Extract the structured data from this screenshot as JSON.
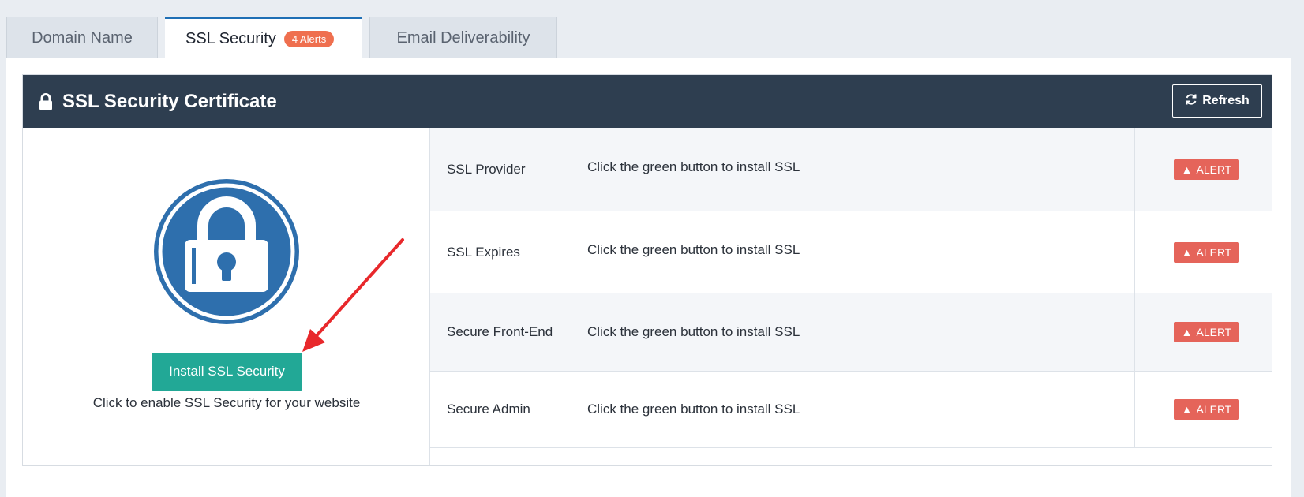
{
  "tabs": [
    {
      "label": "Domain Name"
    },
    {
      "label": "SSL Security",
      "badge": "4 Alerts"
    },
    {
      "label": "Email Deliverability"
    }
  ],
  "card": {
    "title": "SSL Security Certificate",
    "refresh_label": "Refresh",
    "install_label": "Install SSL Security",
    "install_hint": "Click to enable SSL Security for your website"
  },
  "rows": [
    {
      "label": "SSL Provider",
      "value": "Click the green button to install SSL",
      "status": "ALERT"
    },
    {
      "label": "SSL Expires",
      "value": "Click the green button to install SSL",
      "status": "ALERT"
    },
    {
      "label": "Secure Front-End",
      "value": "Click the green button to install SSL",
      "status": "ALERT"
    },
    {
      "label": "Secure Admin",
      "value": "Click the green button to install SSL",
      "status": "ALERT"
    }
  ],
  "colors": {
    "header_bg": "#2e3e50",
    "install_green": "#22a896",
    "alert_red": "#e5645a",
    "badge_orange": "#ef6f4f",
    "lock_blue": "#2e6fad",
    "active_tab_border": "#1f6fb5"
  },
  "icons": {
    "header": "lock-icon",
    "refresh": "refresh-icon",
    "alert": "warning-icon",
    "hero": "padlock-icon",
    "annotation": "red-arrow"
  }
}
